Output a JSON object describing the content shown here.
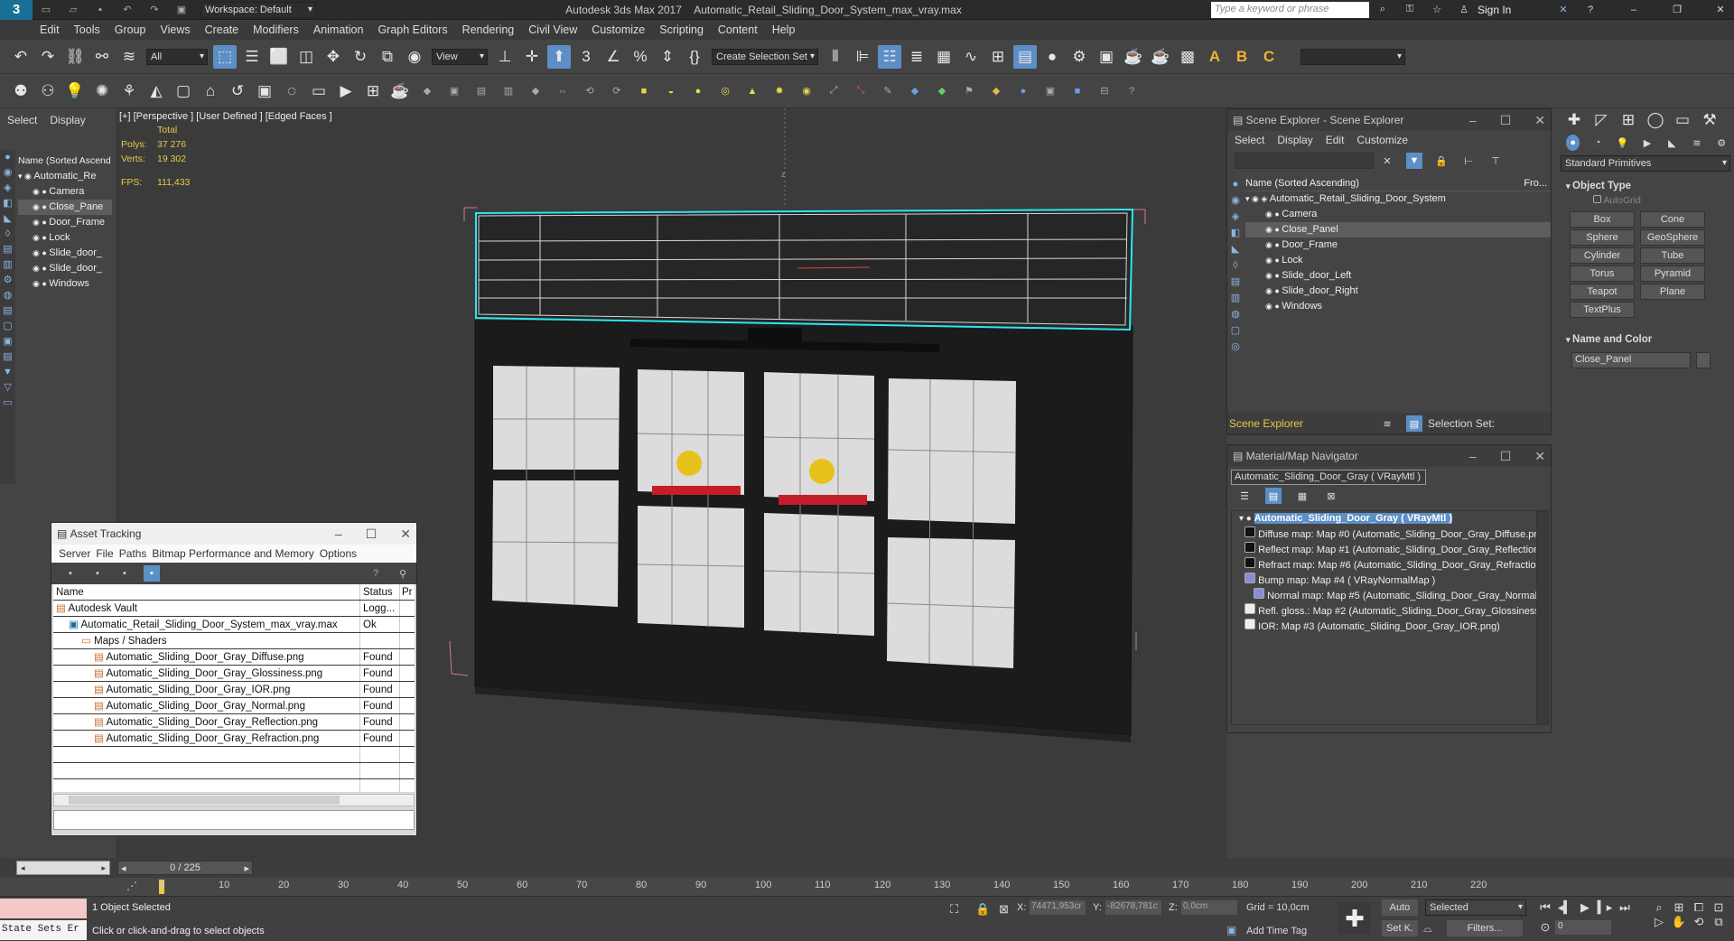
{
  "app": {
    "title": "Autodesk 3ds Max 2017",
    "file": "Automatic_Retail_Sliding_Door_System_max_vray.max",
    "workspace": "Workspace: Default",
    "search_placeholder": "Type a keyword or phrase",
    "sign_in": "Sign In"
  },
  "menu": [
    "Edit",
    "Tools",
    "Group",
    "Views",
    "Create",
    "Modifiers",
    "Animation",
    "Graph Editors",
    "Rendering",
    "Civil View",
    "Customize",
    "Scripting",
    "Content",
    "Help"
  ],
  "toolbar": {
    "filter": "All",
    "view": "View",
    "selection_set": "Create Selection Set"
  },
  "left_panel": {
    "tabs": [
      "Select",
      "Display"
    ],
    "header": "Name (Sorted Ascend",
    "items": [
      "Automatic_Re",
      "Camera",
      "Close_Pane",
      "Door_Frame",
      "Lock",
      "Slide_door_",
      "Slide_door_",
      "Windows"
    ]
  },
  "viewport": {
    "label": "[+] [Perspective ] [User Defined ] [Edged Faces ]",
    "stats_total": "Total",
    "polys_label": "Polys:",
    "polys": "37 276",
    "verts_label": "Verts:",
    "verts": "19 302",
    "fps_label": "FPS:",
    "fps": "111,433",
    "axis_z": "z"
  },
  "scene_explorer": {
    "title": "Scene Explorer - Scene Explorer",
    "menu": [
      "Select",
      "Display",
      "Edit",
      "Customize"
    ],
    "header": "Name (Sorted Ascending)",
    "header_right": "Fro...",
    "root": "Automatic_Retail_Sliding_Door_System",
    "items": [
      "Camera",
      "Close_Panel",
      "Door_Frame",
      "Lock",
      "Slide_door_Left",
      "Slide_door_Right",
      "Windows"
    ],
    "footer_left": "Scene Explorer",
    "footer_right": "Selection Set:"
  },
  "mat_nav": {
    "title": "Material/Map Navigator",
    "current": "Automatic_Sliding_Door_Gray  ( VRayMtl )",
    "root": "Automatic_Sliding_Door_Gray  ( VRayMtl )",
    "items": [
      "Diffuse map: Map #0 (Automatic_Sliding_Door_Gray_Diffuse.pn",
      "Reflect map: Map #1 (Automatic_Sliding_Door_Gray_Reflection",
      "Refract map: Map #6 (Automatic_Sliding_Door_Gray_Refractior",
      "Bump map: Map #4  ( VRayNormalMap )",
      "Normal map: Map #5 (Automatic_Sliding_Door_Gray_Normal.",
      "Refl. gloss.: Map #2 (Automatic_Sliding_Door_Gray_Glossiness.p",
      "IOR: Map #3 (Automatic_Sliding_Door_Gray_IOR.png)"
    ]
  },
  "asset_tracking": {
    "title": "Asset Tracking",
    "menu": [
      "Server",
      "File",
      "Paths",
      "Bitmap Performance and Memory",
      "Options"
    ],
    "col_name": "Name",
    "col_status": "Status",
    "col_p": "Pr",
    "rows": [
      {
        "name": "Autodesk Vault",
        "status": "Logg...",
        "indent": 0
      },
      {
        "name": "Automatic_Retail_Sliding_Door_System_max_vray.max",
        "status": "Ok",
        "indent": 1
      },
      {
        "name": "Maps / Shaders",
        "status": "",
        "indent": 2
      },
      {
        "name": "Automatic_Sliding_Door_Gray_Diffuse.png",
        "status": "Found",
        "indent": 3
      },
      {
        "name": "Automatic_Sliding_Door_Gray_Glossiness.png",
        "status": "Found",
        "indent": 3
      },
      {
        "name": "Automatic_Sliding_Door_Gray_IOR.png",
        "status": "Found",
        "indent": 3
      },
      {
        "name": "Automatic_Sliding_Door_Gray_Normal.png",
        "status": "Found",
        "indent": 3
      },
      {
        "name": "Automatic_Sliding_Door_Gray_Reflection.png",
        "status": "Found",
        "indent": 3
      },
      {
        "name": "Automatic_Sliding_Door_Gray_Refraction.png",
        "status": "Found",
        "indent": 3
      }
    ]
  },
  "command_panel": {
    "category": "Standard Primitives",
    "object_type": "Object Type",
    "autogrid": "AutoGrid",
    "primitives": [
      "Box",
      "Cone",
      "Sphere",
      "GeoSphere",
      "Cylinder",
      "Tube",
      "Torus",
      "Pyramid",
      "Teapot",
      "Plane",
      "TextPlus"
    ],
    "name_color": "Name and Color",
    "object_name": "Close_Panel"
  },
  "timeline": {
    "frame": "0 / 225",
    "ticks": [
      "0",
      "10",
      "20",
      "30",
      "40",
      "50",
      "60",
      "70",
      "80",
      "90",
      "100",
      "110",
      "120",
      "130",
      "140",
      "150",
      "160",
      "170",
      "180",
      "190",
      "200",
      "210",
      "220"
    ]
  },
  "status": {
    "selected": "1 Object Selected",
    "hint": "Click or click-and-drag to select objects",
    "x_label": "X:",
    "x": "74471,953cr",
    "y_label": "Y:",
    "y": "-82678,781c",
    "z_label": "Z:",
    "z": "0,0cm",
    "grid": "Grid = 10,0cm",
    "auto": "Auto",
    "setk": "Set K.",
    "sel_mode": "Selected",
    "filters": "Filters...",
    "add_time_tag": "Add Time Tag",
    "frame_field": "0",
    "state_sets": "State Sets Er"
  },
  "colors": {
    "accent": "#5d8fc7",
    "viewport_bg": "#3b3b3b",
    "selection": "#2ee6ef"
  }
}
